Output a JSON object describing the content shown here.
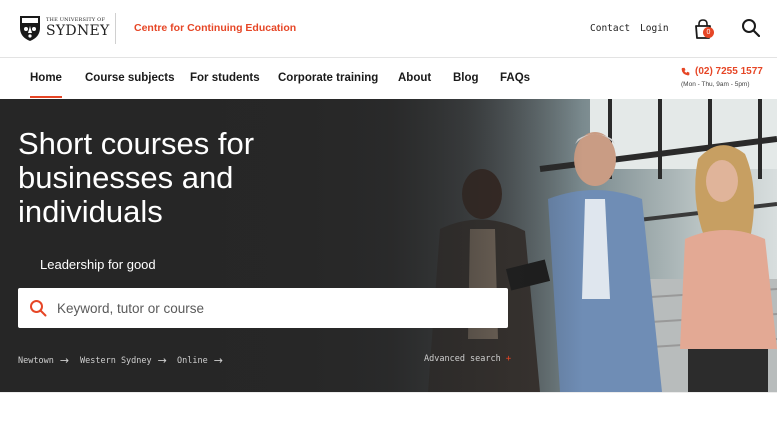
{
  "header": {
    "logo_small": "THE UNIVERSITY OF",
    "logo_big": "SYDNEY",
    "centre_name": "Centre for Continuing Education",
    "contact_label": "Contact",
    "login_label": "Login",
    "cart_count": "0",
    "icons": [
      "crest-icon",
      "cart-icon",
      "search-icon"
    ]
  },
  "nav": {
    "items": [
      {
        "label": "Home",
        "active": true
      },
      {
        "label": "Course subjects"
      },
      {
        "label": "For students"
      },
      {
        "label": "Corporate training"
      },
      {
        "label": "About"
      },
      {
        "label": "Blog"
      },
      {
        "label": "FAQs"
      }
    ],
    "phone": "(02) 7255 1577",
    "hours": "(Mon - Thu, 9am - 5pm)"
  },
  "hero": {
    "title": "Short courses for businesses and individuals",
    "subtitle": "Leadership for good",
    "search_placeholder": "Keyword, tutor or course",
    "quick_links": [
      "Newtown",
      "Western Sydney",
      "Online"
    ],
    "advanced_search": "Advanced search",
    "advanced_symbol": "+"
  },
  "colors": {
    "accent": "#e64626",
    "hero_dark": "#262626",
    "text": "#1a1a1a"
  }
}
